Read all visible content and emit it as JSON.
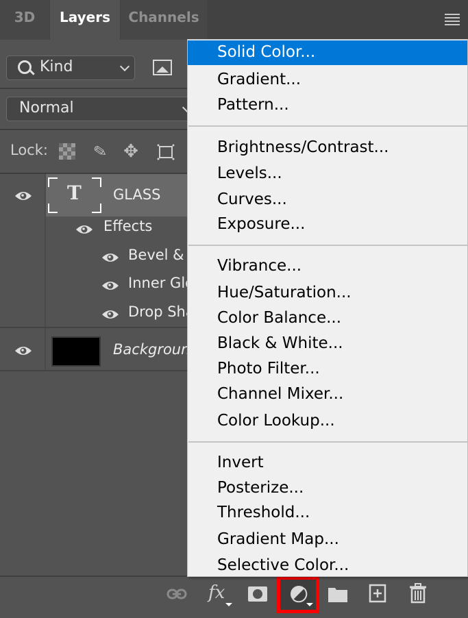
{
  "tabs": [
    {
      "label": "3D",
      "active": false
    },
    {
      "label": "Layers",
      "active": true
    },
    {
      "label": "Channels",
      "active": false
    }
  ],
  "filter": {
    "kind_label": "Kind"
  },
  "blend_mode": {
    "value": "Normal"
  },
  "lock": {
    "label": "Lock:"
  },
  "layers": [
    {
      "name": "GLASS",
      "type": "text",
      "visible": true,
      "selected": true,
      "thumb_glyph": "T",
      "effects": {
        "label": "Effects",
        "items": [
          "Bevel & E",
          "Inner Glo",
          "Drop Sha"
        ]
      }
    },
    {
      "name": "Background",
      "type": "pixel",
      "visible": true,
      "selected": false
    }
  ],
  "menu": {
    "groups": [
      [
        "Solid Color...",
        "Gradient...",
        "Pattern..."
      ],
      [
        "Brightness/Contrast...",
        "Levels...",
        "Curves...",
        "Exposure..."
      ],
      [
        "Vibrance...",
        "Hue/Saturation...",
        "Color Balance...",
        "Black & White...",
        "Photo Filter...",
        "Channel Mixer...",
        "Color Lookup..."
      ],
      [
        "Invert",
        "Posterize...",
        "Threshold...",
        "Gradient Map...",
        "Selective Color..."
      ]
    ],
    "highlighted": "Solid Color...",
    "highlight_color": "#0078d7"
  },
  "bottom_toolbar": {
    "fx_label": "fx",
    "highlight_color": "#ff0000",
    "active_button": "new-fill-adjustment-layer"
  }
}
